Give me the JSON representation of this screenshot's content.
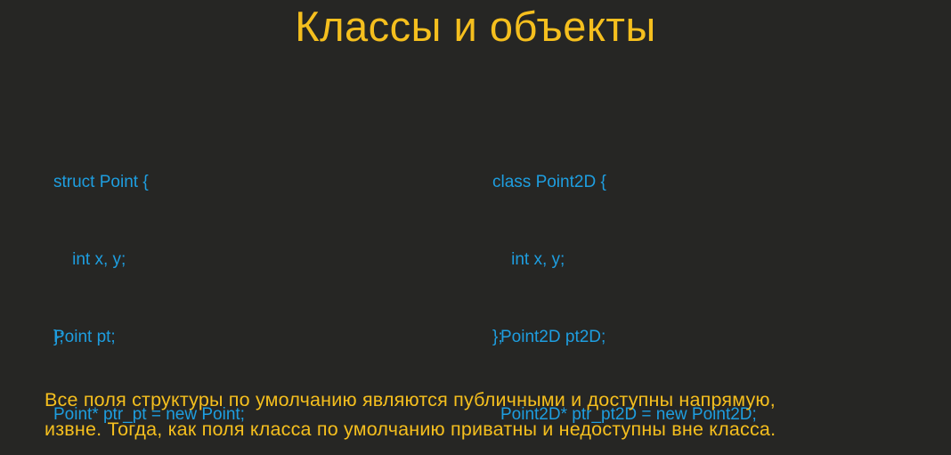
{
  "slide": {
    "title": "Классы и объекты",
    "struct_def": [
      "struct Point {",
      "    int x, y;",
      "};"
    ],
    "class_def": [
      "class Point2D {",
      "    int x, y;",
      "};"
    ],
    "struct_usage": [
      "Point pt;",
      "Point* ptr_pt = new Point;"
    ],
    "class_usage": [
      "Point2D pt2D;",
      "Point2D* ptr_pt2D = new Point2D;"
    ],
    "note": [
      "Все поля структуры по умолчанию являются публичными и доступны напрямую,",
      "извне. Тогда, как поля класса по умолчанию приватны и недоступны вне класса."
    ],
    "colors": {
      "background": "#262624",
      "title": "#f5bf1e",
      "code": "#1e9ee0",
      "note": "#f5bf1e"
    }
  }
}
